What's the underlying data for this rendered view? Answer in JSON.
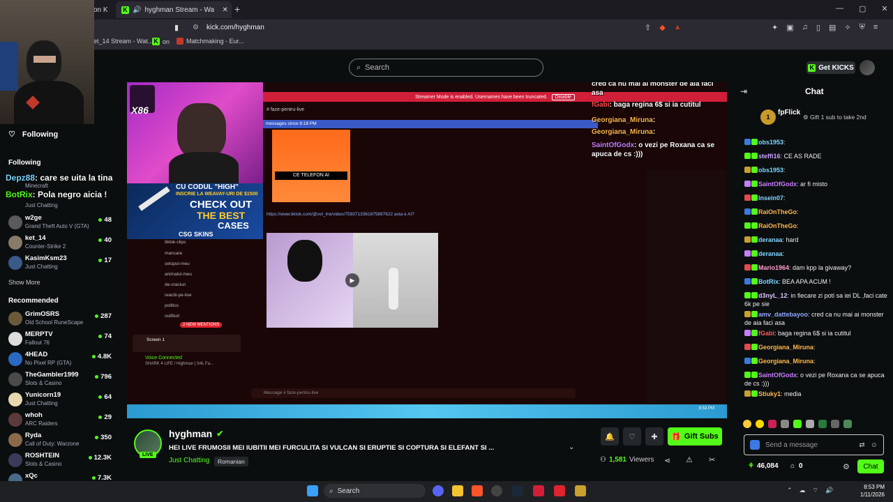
{
  "browser": {
    "tab_prev": "on K",
    "tab_active": "hyghman Stream - Watch Live",
    "url": "kick.com/hyghman",
    "bookmarks": [
      "et_14 Stream - Wat...",
      "on",
      "Matchmaking - Eur..."
    ]
  },
  "kick": {
    "search_placeholder": "Search",
    "get_kicks": "Get KICKS"
  },
  "sidebar": {
    "following_header": "Following",
    "following_label": "Following",
    "following_items": [
      {
        "name": "Minecraft",
        "game": "",
        "count": ""
      },
      {
        "name": "Just Chatting",
        "game": "",
        "count": ""
      },
      {
        "name": "w2ge",
        "game": "Grand Theft Auto V (GTA)",
        "count": "48"
      },
      {
        "name": "ket_14",
        "game": "Counter-Strike 2",
        "count": "40"
      },
      {
        "name": "KasimKsm23",
        "game": "Just Chatting",
        "count": "17"
      }
    ],
    "show_more": "Show More",
    "recommended_header": "Recommended",
    "recommended_items": [
      {
        "name": "GrimOSRS",
        "game": "Old School RuneScape",
        "count": "287"
      },
      {
        "name": "MERPTV",
        "game": "Fallout 76",
        "count": "74"
      },
      {
        "name": "4HEAD",
        "game": "No Pixel RP (GTA)",
        "count": "4.8K"
      },
      {
        "name": "TheGambler1999",
        "game": "Slots & Casino",
        "count": "796"
      },
      {
        "name": "Yunicorn19",
        "game": "Just Chatting",
        "count": "64"
      },
      {
        "name": "whoh",
        "game": "ARC Raiders",
        "count": "29"
      },
      {
        "name": "Ryda",
        "game": "Call of Duty: Warzone",
        "count": "350"
      },
      {
        "name": "ROSHTEIN",
        "game": "Slots & Casino",
        "count": "12.3K"
      },
      {
        "name": "xQc",
        "game": "",
        "count": "7.3K"
      }
    ],
    "overlay_messages": [
      {
        "user": "Depz88",
        "text": ": care se uita la tina"
      },
      {
        "user": "BotRix",
        "text": ": Pola negro aicia !"
      }
    ]
  },
  "video": {
    "discord_channel": "faze-pentru-live",
    "streamer_banner": "Streamer Mode is enabled. Usernames have been truncated.",
    "disable_btn": "Disable",
    "new_messages": "messages since 8:18 PM",
    "tiktok_link": "https://www.tiktok.com/@svt_trw/video/7593713361875897622 asta e AI?",
    "ce_telefon": "CE TELEFON AI",
    "promo_1": "CU CODUL \"HIGH\"",
    "promo_2": "INSCRIE LA WEAVAY-URI DE $1500",
    "promo_3": "CHECK OUT",
    "promo_4": "THE BEST",
    "promo_5": "CASES",
    "promo_brand": "CSG SKINS",
    "x_label": "X86",
    "channels": [
      "tiktok-clips",
      "mancare",
      "setupul-meu",
      "animalul-meu",
      "de-craciun",
      "reactii-pe-live",
      "politics",
      "outfituri"
    ],
    "new_mentions": "2 NEW MENTIONS",
    "voice_connected": "Voice Connected",
    "voice_server": "SHARK 4 LIFE / Highman | S4L Fa...",
    "screen_label": "Screen 1",
    "message_placeholder": "Message # faze-pentru-live",
    "overlay_chat": [
      {
        "user": "",
        "text": "cred ca nu mai ai monster de aia faci asa"
      },
      {
        "user": "fGabi",
        "text": ": baga regina 6$ si ia cutitul"
      },
      {
        "user": "Georgiana_Miruna",
        "text": ":"
      },
      {
        "user": "Georgiana_Miruna",
        "text": ":"
      },
      {
        "user": "SaintOfGodx",
        "text": ": o vezi pe Roxana ca se apuca de cs :)))"
      }
    ],
    "clock": "8:53 PM"
  },
  "chat": {
    "title": "Chat",
    "pinned_user": "fpFlick",
    "pinned_count": "1",
    "pinned_text": "Gift 1 sub to take 2nd",
    "messages": [
      {
        "user": "obs1953",
        "text": ":",
        "color": "#7fd6ff"
      },
      {
        "user": "steffi16",
        "text": ": CE AS RADE",
        "color": "#c8a3ff"
      },
      {
        "user": "obs1953",
        "text": ":",
        "color": "#7fd6ff"
      },
      {
        "user": "SaintOfGodx",
        "text": ": ar fi misto",
        "color": "#c77dff"
      },
      {
        "user": "Insein07",
        "text": ":",
        "color": "#7fd6ff"
      },
      {
        "user": "RaiOnTheGo",
        "text": ":",
        "color": "#ffb84d"
      },
      {
        "user": "RaiOnTheGo",
        "text": ":",
        "color": "#ffb84d"
      },
      {
        "user": "deranaa",
        "text": ": hard",
        "color": "#7fd6ff"
      },
      {
        "user": "deranaa",
        "text": ":",
        "color": "#7fd6ff"
      },
      {
        "user": "Mario1964",
        "text": ": dam kpp la givaway?",
        "color": "#ff9ecf"
      },
      {
        "user": "BotRix",
        "text": ": BEA APA ACUM !",
        "color": "#7fd6ff"
      },
      {
        "user": "d3nyL_12",
        "text": ": in fiecare zi poti sa iei DL ,faci cate 6k pe sie",
        "color": "#e0c0ff"
      },
      {
        "user": "amv_dattebayoo",
        "text": ": cred ca nu mai ai monster de aia faci asa",
        "color": "#8fa8ff"
      },
      {
        "user": "fGabi",
        "text": ": baga regina 6$ si ia cutitul",
        "color": "#ff5a5a"
      },
      {
        "user": "Georgiana_Miruna",
        "text": ":",
        "color": "#ffb84d"
      },
      {
        "user": "Georgiana_Miruna",
        "text": ":",
        "color": "#ffb84d"
      },
      {
        "user": "SaintOfGodx",
        "text": ": o vezi pe Roxana ca se apuca de cs :)))",
        "color": "#c77dff"
      },
      {
        "user": "Stiuky1",
        "text": ": media",
        "color": "#ffb84d"
      }
    ],
    "input_placeholder": "Send a message",
    "points": "46,084",
    "second_count": "0",
    "chat_btn": "Chat"
  },
  "stream": {
    "streamer": "hyghman",
    "live_label": "LIVE",
    "title": "HEI LIVE FRUMOSII MEI IUBITII MEI FURCULITA SI VULCAN SI ERUPTIE SI COPTURA SI ELEFANT SI ...",
    "category": "Just Chatting",
    "language_tag": "Romanian",
    "viewers": "1,581",
    "viewers_label": "Viewers",
    "gift_subs": "Gift Subs"
  },
  "taskbar": {
    "search_placeholder": "Search",
    "time": "8:53 PM",
    "date": "1/11/2026"
  },
  "colors": {
    "accent": "#53fc18",
    "bg": "#0b0e0f"
  }
}
